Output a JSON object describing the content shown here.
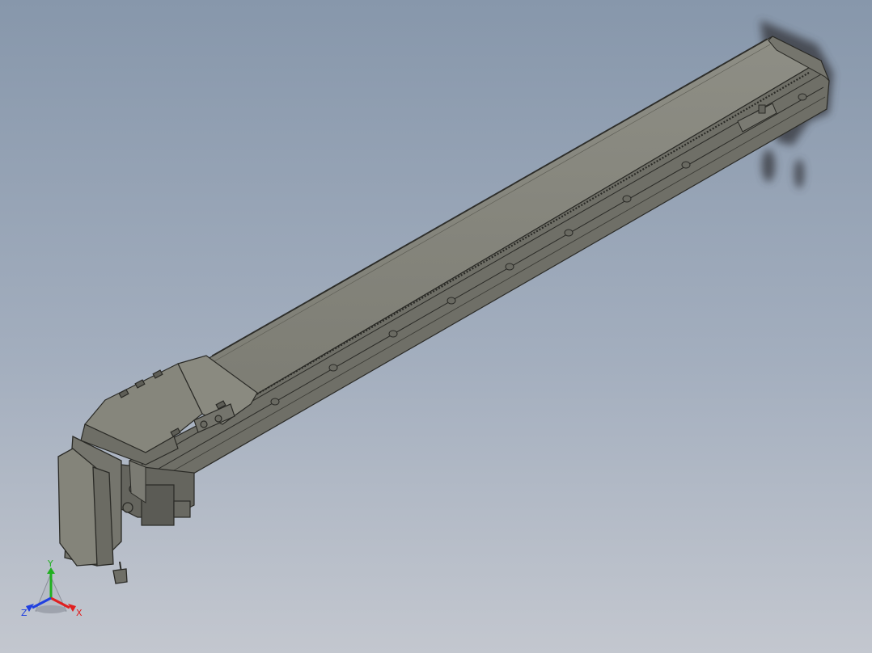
{
  "viewport": {
    "background_top": "#8797ab",
    "background_bottom": "#c3c7cf"
  },
  "model": {
    "body_color": "#84847a",
    "top_face_color": "#8c8c82",
    "edge_color": "#2a2a26",
    "shadow_color": "#3e3f47"
  },
  "triad": {
    "x_label": "X",
    "y_label": "Y",
    "z_label": "Z",
    "x_color": "#e02020",
    "y_color": "#20b020",
    "z_color": "#2040e0"
  }
}
